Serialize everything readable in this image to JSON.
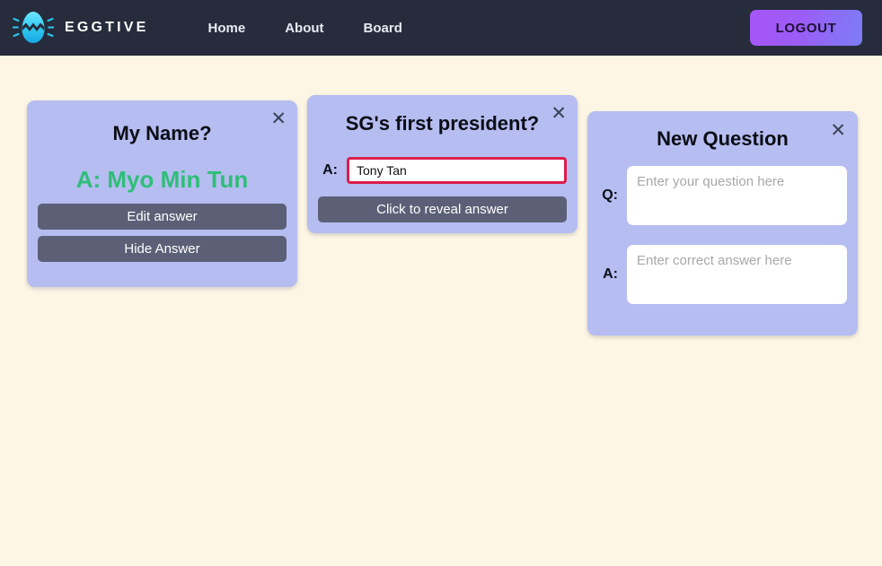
{
  "header": {
    "logo_icon": "cracked-egg-icon",
    "brand": "EGGTIVE",
    "nav": [
      {
        "label": "Home",
        "name": "nav-link-home"
      },
      {
        "label": "About",
        "name": "nav-link-about"
      },
      {
        "label": "Board",
        "name": "nav-link-board"
      }
    ],
    "logout_label": "LOGOUT",
    "colors": {
      "bar_background": "#262c3c",
      "brand_text": "#ffffff",
      "nav_text": "#e7eaf2",
      "logout_gradient_start": "#a855f7",
      "logout_gradient_end": "#7c7df5",
      "logout_text": "#1d1033"
    }
  },
  "page": {
    "background": "#fdf6e5"
  },
  "cards": {
    "answered": {
      "title": "My Name?",
      "close_icon": "close-icon",
      "answer": "A: Myo Min Tun",
      "answer_color": "#2fbe78",
      "edit_label": "Edit answer",
      "hide_label": "Hide Answer",
      "background": "#b5bdf1",
      "button_background": "#5c6076"
    },
    "guessing": {
      "title": "SG's first president?",
      "close_icon": "close-icon",
      "answer_label": "A:",
      "answer_value": "Tony Tan",
      "answer_placeholder": "",
      "input_border_color": "#dc1e4c",
      "reveal_label": "Click to reveal answer"
    },
    "new_question": {
      "title": "New Question",
      "close_icon": "close-icon",
      "question_label": "Q:",
      "question_value": "",
      "question_placeholder": "Enter your question here",
      "answer_label": "A:",
      "answer_value": "",
      "answer_placeholder": "Enter correct answer here"
    }
  }
}
